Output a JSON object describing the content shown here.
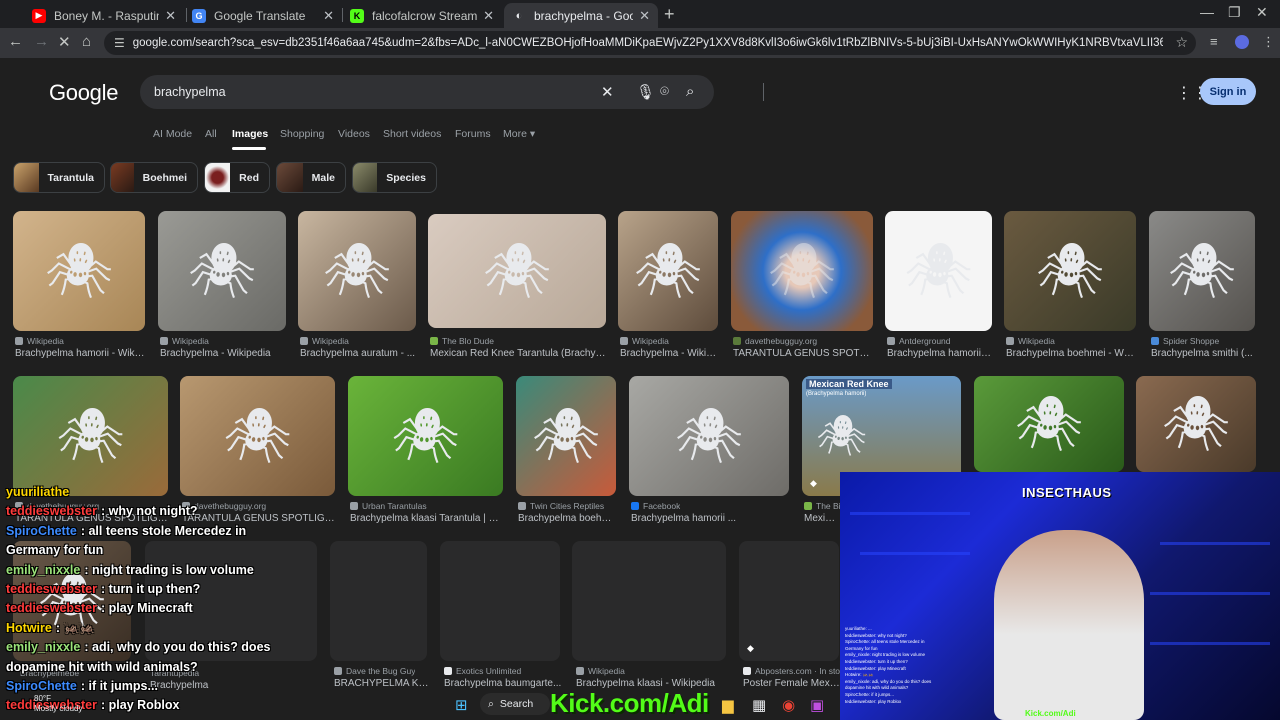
{
  "tabs": [
    {
      "title": "Boney M. - Rasputin (Sopot Fe",
      "color": "#ff0000"
    },
    {
      "title": "Google Translate",
      "color": "#4285f4"
    },
    {
      "title": "falcofalcrow Stream - Watch Li",
      "color": "#53fc18"
    },
    {
      "title": "brachypelma - Google Search",
      "color": "#e8eaed"
    }
  ],
  "url": "google.com/search?sca_esv=db2351f46a6aa745&udm=2&fbs=ADc_l-aN0CWEZBOHjofHoaMMDiKpaEWjvZ2Py1XXV8d8KvlI3o6iwGk6lv1tRbZlBNIVs-5-bUj3iBI-UxHsANYwOkWWIHyK1NRBVtxaVLII368r1o6iGYaS4PFE4_J9pFcEtANXN9Q3vq-U1wPqwBRk...",
  "google": {
    "logo": "Google",
    "query": "brachypelma",
    "sign_in": "Sign in",
    "nav": [
      "AI Mode",
      "All",
      "Images",
      "Shopping",
      "Videos",
      "Short videos",
      "Forums",
      "More"
    ],
    "chips": [
      "Tarantula",
      "Boehmei",
      "Red",
      "Male",
      "Species"
    ],
    "row1": [
      {
        "source": "Wikipedia",
        "caption": "Brachypelma hamorii - Wiki..."
      },
      {
        "source": "Wikipedia",
        "caption": "Brachypelma - Wikipedia"
      },
      {
        "source": "Wikipedia",
        "caption": "Brachypelma auratum - ..."
      },
      {
        "source": "The Blo Dude",
        "caption": "Mexican Red Knee Tarantula (Brachyp..."
      },
      {
        "source": "Wikipedia",
        "caption": "Brachypelma - Wikip..."
      },
      {
        "source": "davethebugguy.org",
        "caption": "TARANTULA GENUS SPOTLIG..."
      },
      {
        "source": "Antderground",
        "caption": "Brachypelma hamorii ..."
      },
      {
        "source": "Wikipedia",
        "caption": "Brachypelma boehmei - Wik..."
      },
      {
        "source": "Spider Shoppe",
        "caption": "Brachypelma smithi (..."
      }
    ],
    "row2": [
      {
        "source": "davethebugguy.org",
        "caption": "TARANTULA GENUS SPOTLIGHT:..."
      },
      {
        "source": "davethebugguy.org",
        "caption": "TARANTULA GENUS SPOTLIGHT:..."
      },
      {
        "source": "Urban Tarantulas",
        "caption": "Brachypelma klaasi Tarantula | M..."
      },
      {
        "source": "Twin Cities Reptiles",
        "caption": "Brachypelma boehm..."
      },
      {
        "source": "Facebook",
        "caption": "Brachypelma hamorii ..."
      },
      {
        "source": "The Bi",
        "caption": "Mexican"
      },
      {
        "source": "",
        "caption": ""
      },
      {
        "source": "",
        "caption": ""
      }
    ],
    "row2_overlay_text": "Mexican Red Knee",
    "row2_overlay_sub": "(Brachypelma hamorii)",
    "row3": [
      {
        "source": "Dave the Bug Guy",
        "caption": "BRACHYPELMA KL..."
      },
      {
        "source": "Exotics Unlimited",
        "caption": "Brachypelma baumgarte..."
      },
      {
        "source": "Wikipedia",
        "caption": "Brachypelma klaasi - Wikipedia"
      },
      {
        "source": "Abposters.com · In stock",
        "caption": "Poster Female Mexican"
      }
    ],
    "row3_partial_captions": [
      "Brachypelmebe",
      "Tarantupedia",
      "Brachypelma"
    ]
  },
  "chat": [
    {
      "user": "yuuriliathe",
      "text": "",
      "color": "#ffd700"
    },
    {
      "user": "teddieswebster",
      "text": ": why not night?",
      "color": "#ff3b3b"
    },
    {
      "user": "SpiroChette",
      "text": ": all teens stole Mercedez in",
      "color": "#3d8bff"
    },
    {
      "user": "",
      "text": "Germany for fun",
      "color": "#ffffff"
    },
    {
      "user": "emily_nixxle",
      "text": ": night trading is low volume",
      "color": "#9be37a"
    },
    {
      "user": "teddieswebster",
      "text": ": turn it up then?",
      "color": "#ff3b3b"
    },
    {
      "user": "teddieswebster",
      "text": ": play Minecraft",
      "color": "#ff3b3b"
    },
    {
      "user": "Hotwire",
      "text": ": 🦗🦗",
      "color": "#ffd700"
    },
    {
      "user": "emily_nixxle",
      "text": ": adi, why do you do this? does",
      "color": "#9be37a"
    },
    {
      "user": "",
      "text": "dopamine hit with wild animals?",
      "color": "#ffffff"
    },
    {
      "user": "SpiroChette",
      "text": ": if it jumps...",
      "color": "#3d8bff"
    },
    {
      "user": "teddieswebster",
      "text": ": play Roblox",
      "color": "#ff3b3b"
    }
  ],
  "webcam": {
    "title": "INSECTHAUS",
    "kick_small": "Kick.com/Adi",
    "mini_chat": [
      "yuuriliathe: ...",
      "teddieswebster: why not night?",
      "SpiroChette: all teens stole Mercedez in",
      "Germany for fun",
      "emily_nixxle: night trading is low volume",
      "teddieswebster: turn it up then?",
      "teddieswebster: play Minecraft",
      "Hotwire: 🦗🦗",
      "emily_nixxle: adi, why do you do this? does",
      "dopamine hit with wild animals?",
      "SpiroChette: if it jumps...",
      "teddieswebster: play Roblox"
    ]
  },
  "kick_banner": "Kick.com/Adi",
  "taskbar": {
    "weather_temp": "80°F",
    "weather_desc": "Mostly cloudy",
    "search": "Search"
  }
}
